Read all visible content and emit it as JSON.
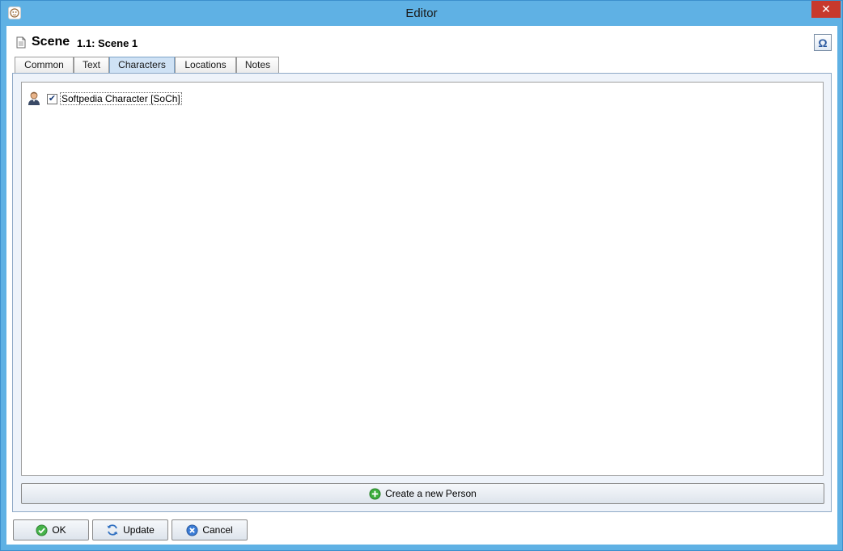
{
  "window": {
    "title": "Editor",
    "close_label": "✕"
  },
  "header": {
    "label": "Scene",
    "scene_id": "1.1: Scene 1",
    "omega_label": "Ω"
  },
  "tabs": [
    {
      "label": "Common"
    },
    {
      "label": "Text"
    },
    {
      "label": "Characters",
      "active": true
    },
    {
      "label": "Locations"
    },
    {
      "label": "Notes"
    }
  ],
  "characters": {
    "items": [
      {
        "label": "Softpedia Character [SoCh]",
        "checked": true,
        "check_glyph": "✔"
      }
    ],
    "create_label": "Create a new Person"
  },
  "footer": {
    "ok_label": "OK",
    "update_label": "Update",
    "cancel_label": "Cancel"
  },
  "colors": {
    "titlebar": "#5fb1e4",
    "close": "#c7392c",
    "active_tab": "#cfe2f5",
    "create_icon": "#3cae3c",
    "cancel_icon": "#3b7cd6"
  },
  "icons": {
    "app": "app-logo-icon",
    "document": "document-icon",
    "person": "person-icon",
    "add": "add-circle-icon",
    "ok": "check-circle-icon",
    "update": "refresh-icon",
    "cancel": "cancel-circle-icon"
  }
}
